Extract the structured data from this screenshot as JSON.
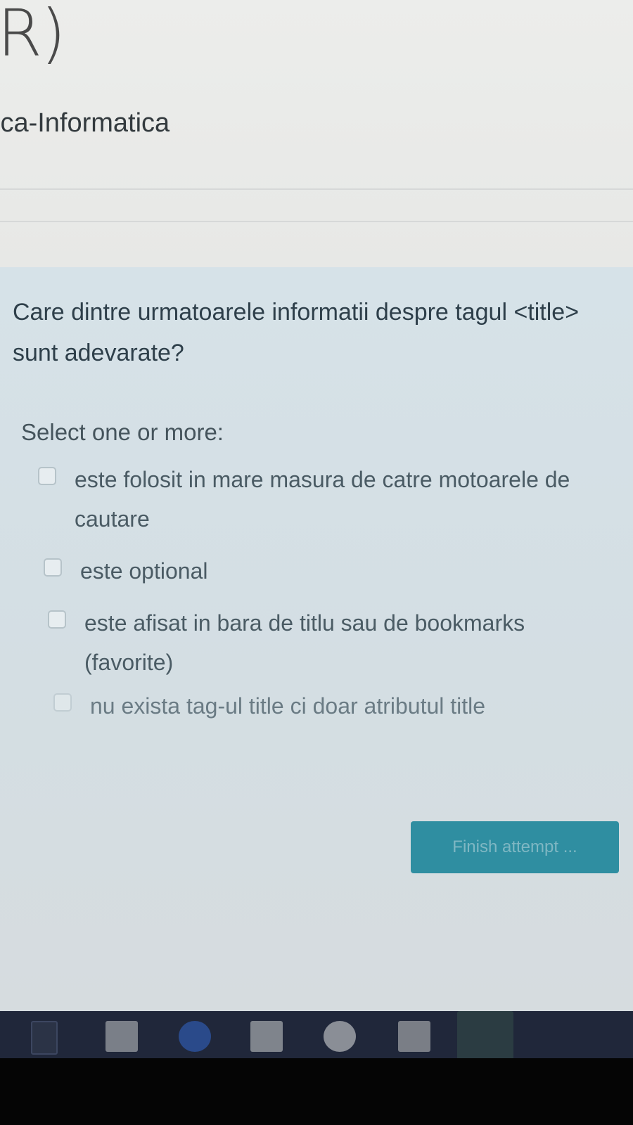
{
  "header": {
    "course_abbr": "R)",
    "course_name": "ica-Informatica"
  },
  "question": {
    "text": "Care dintre urmatoarele informatii despre tagul <title> sunt adevarate?",
    "prompt": "Select one or more:",
    "options": [
      {
        "label": "este folosit in mare masura de catre motoarele de cautare",
        "checked": false
      },
      {
        "label": "este optional",
        "checked": false
      },
      {
        "label": "este afisat in bara de titlu sau de bookmarks (favorite)",
        "checked": false
      },
      {
        "label": "nu exista tag-ul title ci doar atributul title",
        "checked": false
      }
    ]
  },
  "actions": {
    "finish_label": "Finish attempt ..."
  },
  "taskbar": {
    "items": [
      "task-view-icon",
      "store-icon",
      "edge-icon",
      "file-explorer-icon",
      "app-icon",
      "windows-store-icon",
      "app-icon-2"
    ]
  },
  "colors": {
    "accent": "#2f8ea1",
    "taskbar": "#20273a"
  }
}
